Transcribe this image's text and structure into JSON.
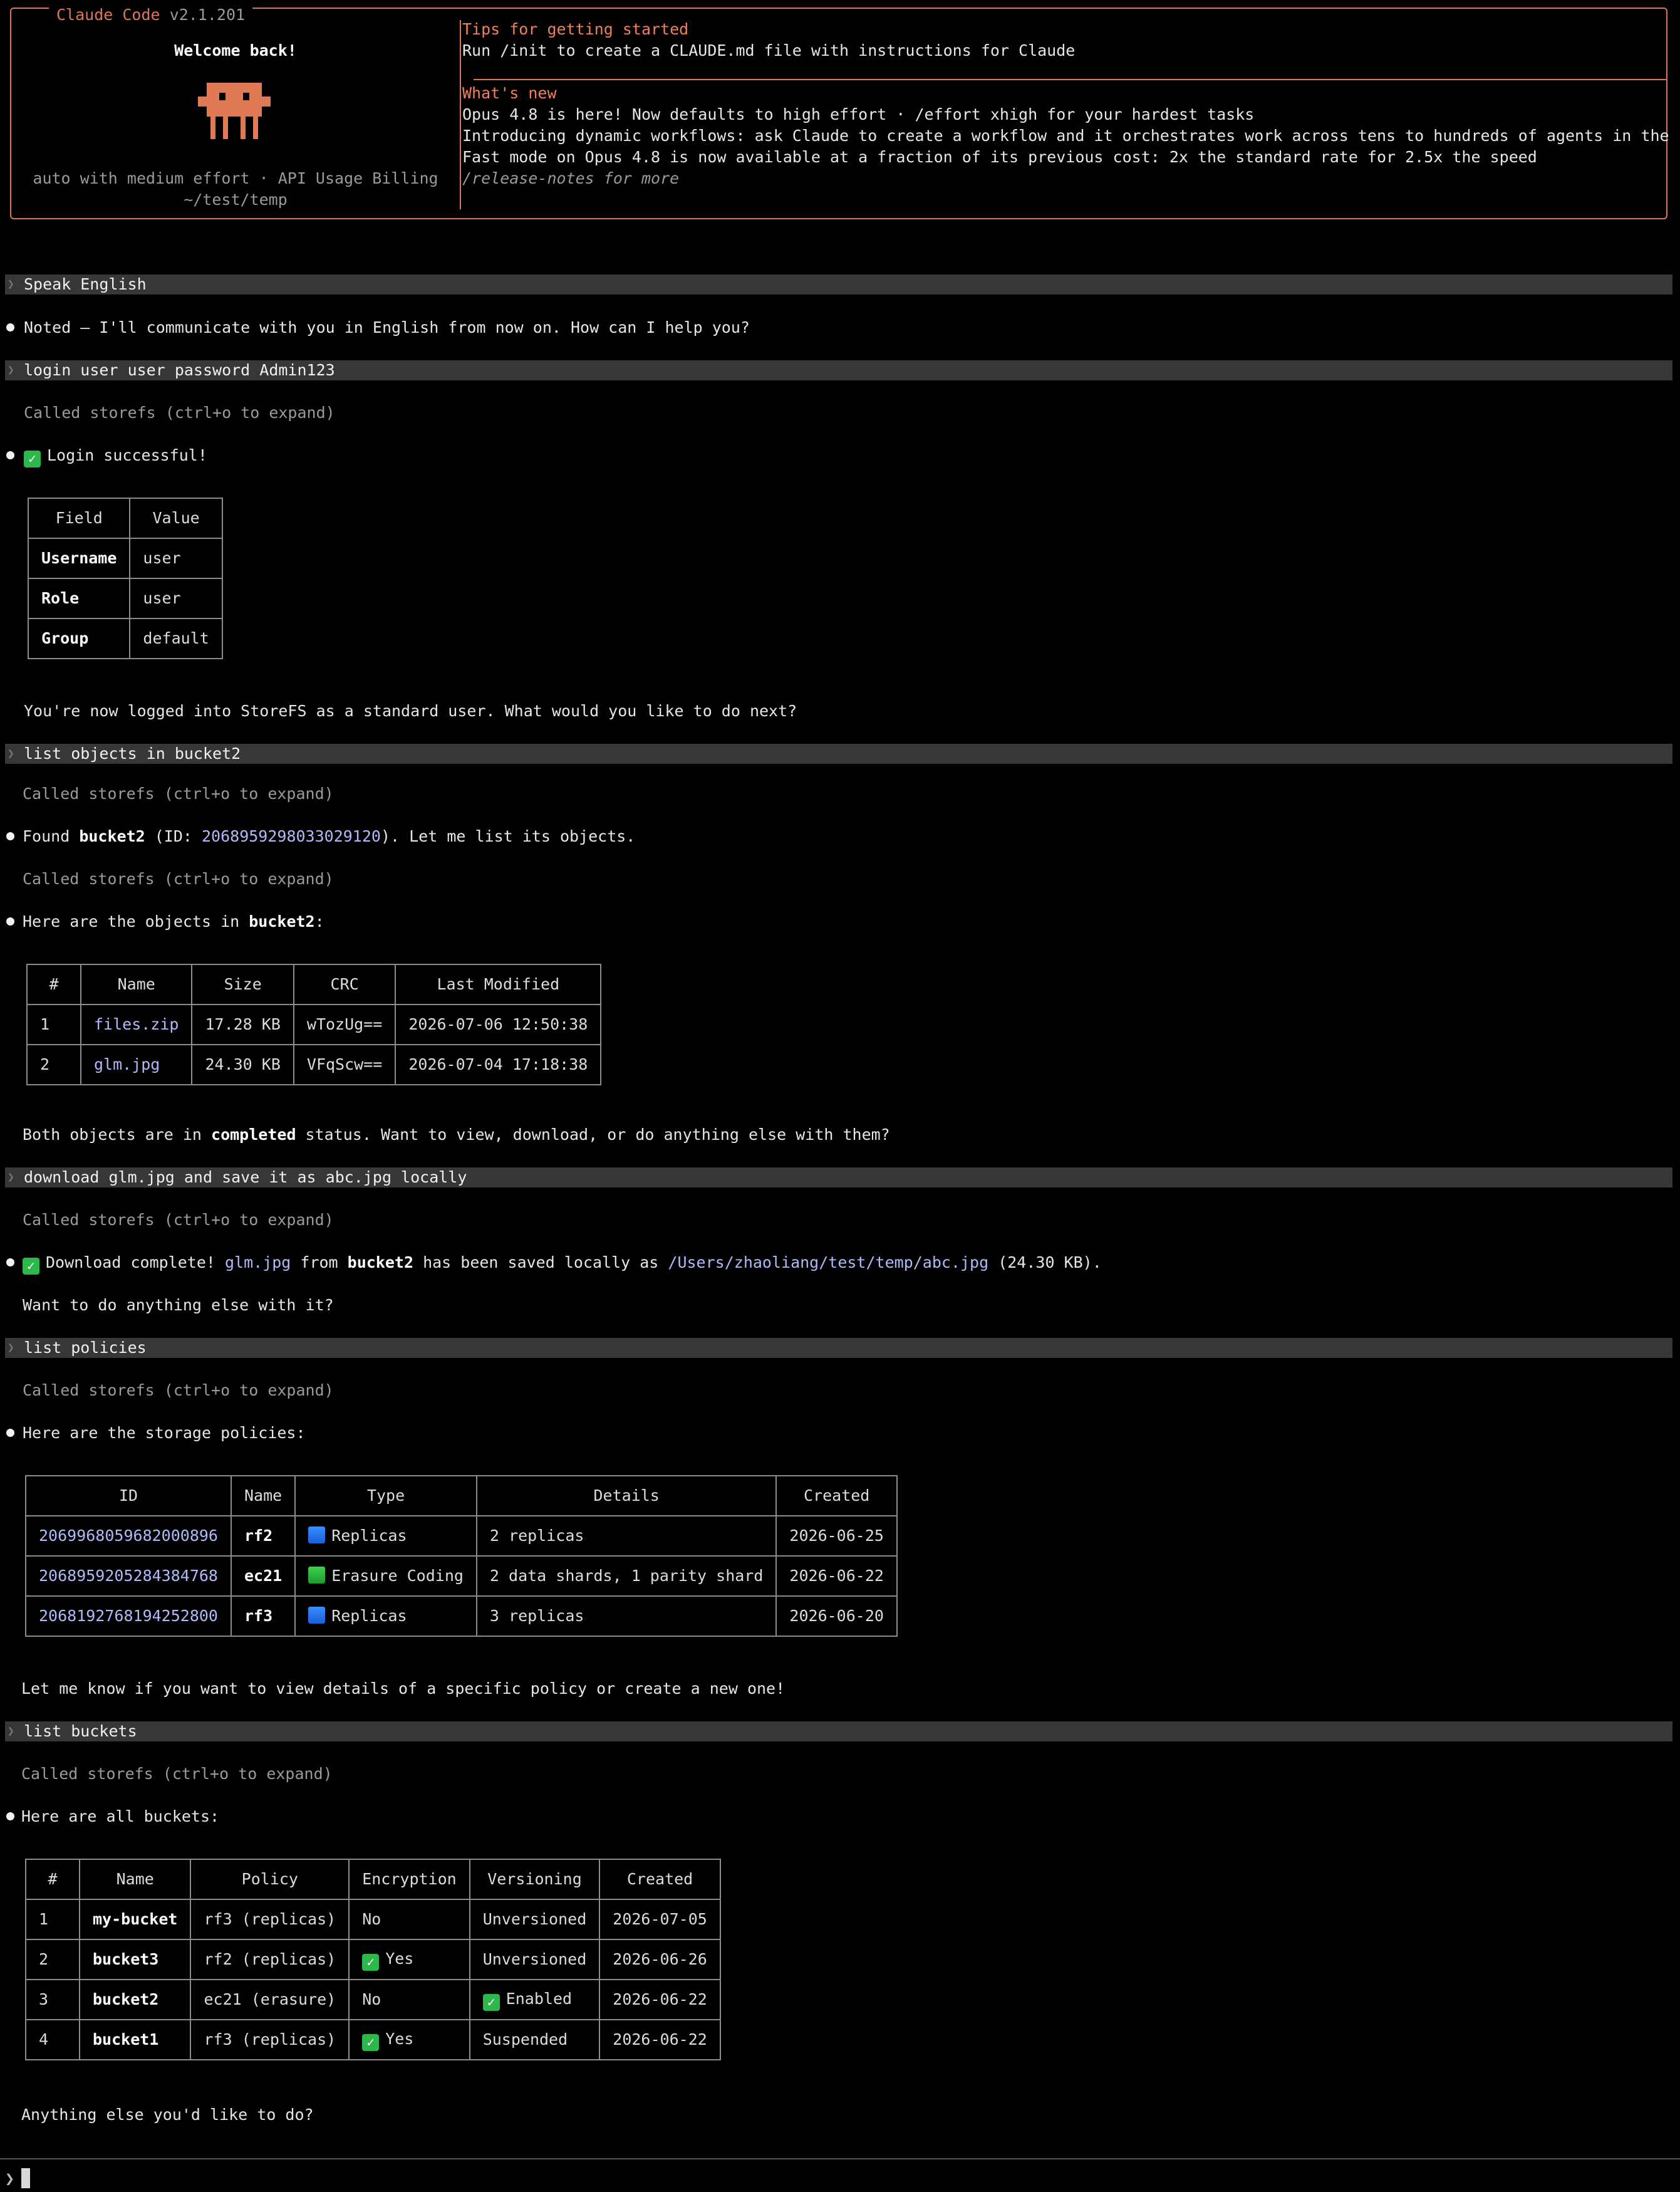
{
  "header": {
    "app_name": "Claude Code",
    "version": "v2.1.201",
    "welcome": "Welcome back!",
    "mode_line": "auto with medium effort · API Usage Billing",
    "cwd": "~/test/temp",
    "tips_title": "Tips for getting started",
    "tips_text": "Run /init to create a CLAUDE.md file with instructions for Claude",
    "news_title": "What's new",
    "news": [
      "Opus 4.8 is here! Now defaults to high effort · /effort xhigh for your hardest tasks",
      "Introducing dynamic workflows: ask Claude to create a workflow and it orchestrates work across tens to hundreds of agents in the backgr…",
      "Fast mode on Opus 4.8 is now available at a fraction of its previous cost: 2x the standard rate for 2.5x the speed"
    ],
    "release_notes": "/release-notes for more"
  },
  "called_text": "Called storefs (ctrl+o to expand)",
  "prompts": {
    "p1": "Speak English",
    "p2": "login user user password Admin123",
    "p3": "list objects in bucket2",
    "p4": "download glm.jpg and save it as abc.jpg locally",
    "p5": "list policies",
    "p6": "list buckets"
  },
  "msgs": {
    "m1": "Noted — I'll communicate with you in English from now on. How can I help you?",
    "m2": "Login successful!",
    "m3": "You're now logged into StoreFS as a standard user. What would you like to do next?",
    "m4_a": "Found ",
    "m4_b": "bucket2",
    "m4_c": " (ID: ",
    "m4_d": "2068959298033029120",
    "m4_e": "). Let me list its objects.",
    "m5_a": "Here are the objects in ",
    "m5_b": "bucket2",
    "m5_c": ":",
    "m6_a": "Both objects are in ",
    "m6_b": "completed",
    "m6_c": " status. Want to view, download, or do anything else with them?",
    "m7_a": "Download complete! ",
    "m7_b": "glm.jpg",
    "m7_c": " from ",
    "m7_d": "bucket2",
    "m7_e": " has been saved locally as ",
    "m7_f": "/Users/zhaoliang/test/temp/abc.jpg",
    "m7_g": " (24.30 KB).",
    "m8": "Want to do anything else with it?",
    "m9": "Here are the storage policies:",
    "m10": "Let me know if you want to view details of a specific policy or create a new one!",
    "m11": "Here are all buckets:",
    "m12": "Anything else you'd like to do?"
  },
  "login_table": {
    "headers": [
      "Field",
      "Value"
    ],
    "rows": [
      [
        "Username",
        "user"
      ],
      [
        "Role",
        "user"
      ],
      [
        "Group",
        "default"
      ]
    ]
  },
  "objects_table": {
    "headers": [
      "#",
      "Name",
      "Size",
      "CRC",
      "Last Modified"
    ],
    "rows": [
      [
        "1",
        "files.zip",
        "17.28 KB",
        "wTozUg==",
        "2026-07-06 12:50:38"
      ],
      [
        "2",
        "glm.jpg",
        "24.30 KB",
        "VFqScw==",
        "2026-07-04 17:18:38"
      ]
    ]
  },
  "policies_table": {
    "headers": [
      "ID",
      "Name",
      "Type",
      "Details",
      "Created"
    ],
    "rows": [
      [
        "2069968059682000896",
        "rf2",
        "Replicas",
        "2 replicas",
        "2026-06-25"
      ],
      [
        "2068959205284384768",
        "ec21",
        "Erasure Coding",
        "2 data shards, 1 parity shard",
        "2026-06-22"
      ],
      [
        "2068192768194252800",
        "rf3",
        "Replicas",
        "3 replicas",
        "2026-06-20"
      ]
    ]
  },
  "buckets_table": {
    "headers": [
      "#",
      "Name",
      "Policy",
      "Encryption",
      "Versioning",
      "Created"
    ],
    "rows": [
      [
        "1",
        "my-bucket",
        "rf3 (replicas)",
        "No",
        "Unversioned",
        "2026-07-05"
      ],
      [
        "2",
        "bucket3",
        "rf2 (replicas)",
        "Yes",
        "Unversioned",
        "2026-06-26"
      ],
      [
        "3",
        "bucket2",
        "ec21 (erasure)",
        "No",
        "Enabled",
        "2026-06-22"
      ],
      [
        "4",
        "bucket1",
        "rf3 (replicas)",
        "Yes",
        "Suspended",
        "2026-06-22"
      ]
    ]
  },
  "input": {
    "prompt_symbol": "❯"
  },
  "colors": {
    "accent": "#d97757",
    "link": "#b1b9f9",
    "prompt_bar": "#373737"
  },
  "icons": {
    "check": "check-mark-icon",
    "replicas": "blue-square-icon",
    "erasure": "green-square-icon",
    "mascot": "claude-mascot-icon"
  }
}
